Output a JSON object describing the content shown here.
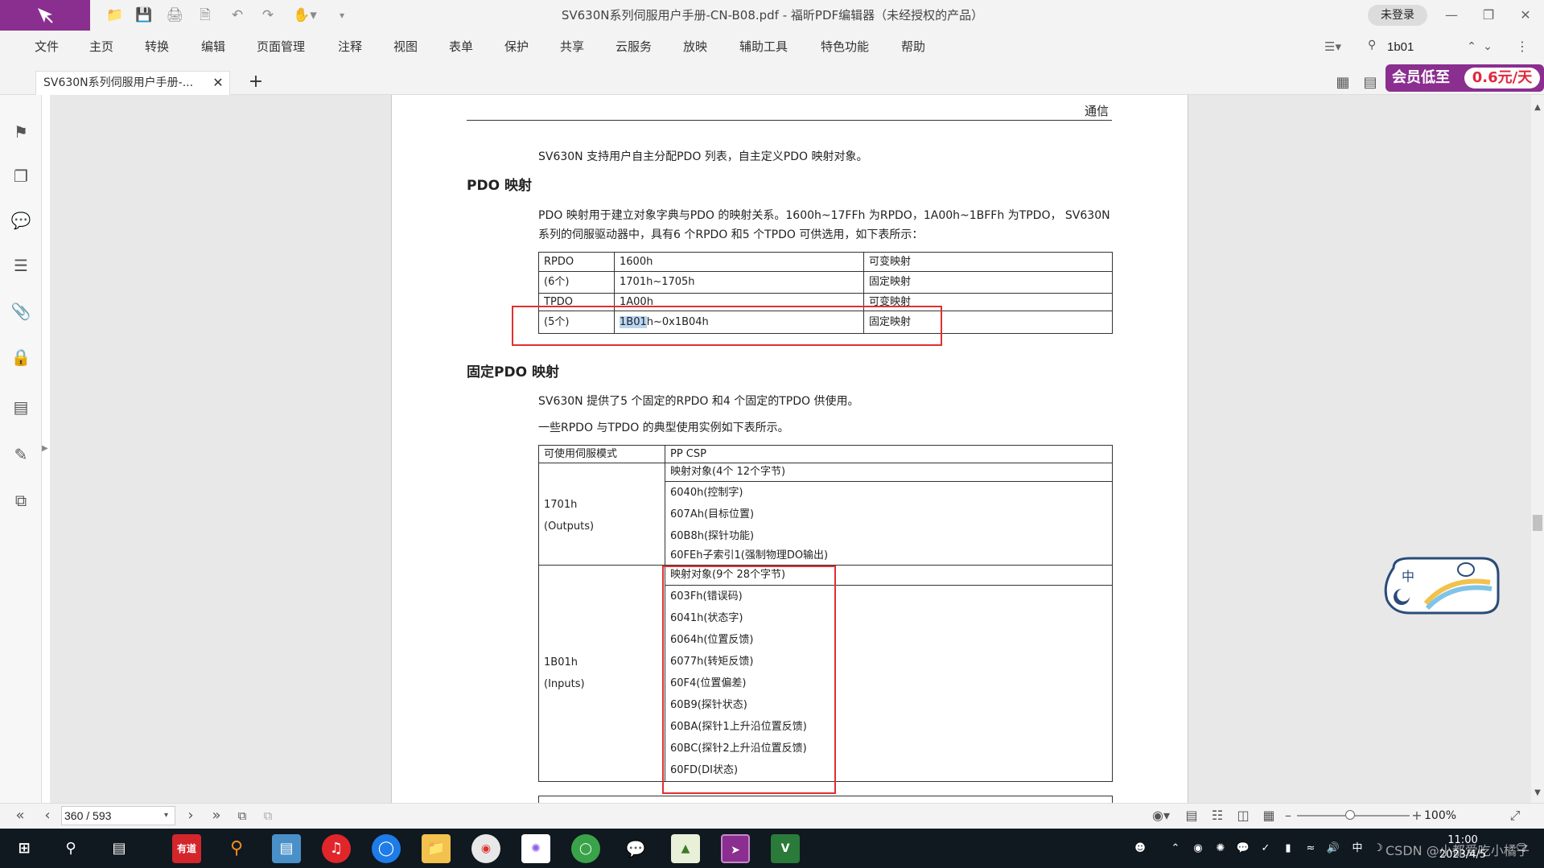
{
  "window": {
    "title": "SV630N系列伺服用户手册-CN-B08.pdf - 福昕PDF编辑器（未经授权的产品）",
    "login_label": "未登录"
  },
  "menu": {
    "items": [
      "文件",
      "主页",
      "转换",
      "编辑",
      "页面管理",
      "注释",
      "视图",
      "表单",
      "保护",
      "共享",
      "云服务",
      "放映",
      "辅助工具",
      "特色功能",
      "帮助"
    ]
  },
  "search": {
    "value": "1b01"
  },
  "tab": {
    "label": "SV630N系列伺服用户手册-..."
  },
  "promo": {
    "text": "会员低至",
    "price": "0.6元/天"
  },
  "sidebar": {
    "icons": [
      "bookmark-icon",
      "pages-icon",
      "comments-icon",
      "layers-icon",
      "attachment-icon",
      "security-icon",
      "form-icon",
      "signature-icon",
      "compare-icon"
    ]
  },
  "pdf": {
    "header": "通信",
    "intro": "SV630N 支持用户自主分配PDO 列表，自主定义PDO 映射对象。",
    "heading1": "PDO 映射",
    "para1_line1": "PDO 映射用于建立对象字典与PDO 的映射关系。1600h~17FFh 为RPDO，1A00h~1BFFh 为TPDO， SV630N",
    "para1_line2": "系列的伺服驱动器中，具有6 个RPDO 和5 个TPDO 可供选用，如下表所示：",
    "table1": {
      "rows": [
        [
          "RPDO",
          "1600h",
          "可变映射"
        ],
        [
          "(6个)",
          "1701h~1705h",
          "固定映射"
        ],
        [
          "TPDO",
          "1A00h",
          "可变映射"
        ],
        [
          "(5个)",
          "1B01h~0x1B04h",
          "固定映射"
        ]
      ],
      "highlight_prefix": "1B01",
      "highlight_rest": "h~0x1B04h"
    },
    "heading2": "固定PDO 映射",
    "para2": "SV630N 提供了5 个固定的RPDO 和4 个固定的TPDO 供使用。",
    "para3": "一些RPDO 与TPDO 的典型使用实例如下表所示。",
    "table2": {
      "header_left": "可使用伺服模式",
      "header_right": "PP CSP",
      "out_label1": "1701h",
      "out_label2": "(Outputs)",
      "out_title": "映射对象(4个 12个字节)",
      "out_items": [
        "6040h(控制字)",
        "607Ah(目标位置)",
        "60B8h(探针功能)",
        "60FEh子索引1(强制物理DO输出)"
      ],
      "in_label1": "1B01h",
      "in_label2": "(Inputs)",
      "in_title": "映射对象(9个 28个字节)",
      "in_items": [
        "603Fh(错误码)",
        "6041h(状态字)",
        "6064h(位置反馈)",
        "6077h(转矩反馈)",
        "60F4(位置偏差)",
        "60B9(探针状态)",
        "60BA(探针1上升沿位置反馈)",
        "60BC(探针2上升沿位置反馈)",
        "60FD(DI状态)"
      ]
    }
  },
  "status": {
    "page": "360 / 593",
    "zoom": "100%"
  },
  "taskbar": {
    "youdao": "有道",
    "time": "11:00",
    "date": "2023/4/5",
    "watermark": "CSDN @小都爱吃小橘子",
    "ime": "中"
  },
  "colors": {
    "brand": "#8a2e8f",
    "annotation_red": "#e03030",
    "selection": "#b9d5f2"
  }
}
